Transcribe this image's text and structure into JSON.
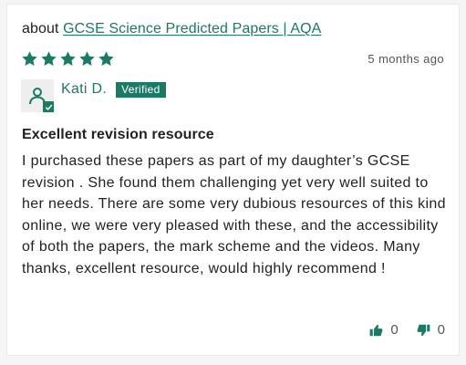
{
  "review": {
    "about_prefix": "about",
    "product_link": "GCSE Science Predicted Papers | AQA",
    "rating": 5,
    "rating_max": 5,
    "time_ago": "5 months ago",
    "reviewer_name": "Kati D.",
    "verified_label": "Verified",
    "title": "Excellent revision resource",
    "body": "I purchased these papers as part of my daughter’s GCSE revision . She found them challenging yet very well suited to her needs. There are some very dubious resources of this kind online, we were very pleased with these, and the accessibility of both the papers, the mark scheme and the videos. Many thanks, excellent resource, would highly recommend !",
    "upvotes": "0",
    "downvotes": "0"
  },
  "colors": {
    "accent": "#1b7a63",
    "text": "#222222",
    "muted": "#555555",
    "background": "#f5f5f5",
    "card": "#ffffff"
  },
  "icons": {
    "star": "star-icon",
    "user": "user-icon",
    "check": "check-icon",
    "thumbs_up": "thumbs-up-icon",
    "thumbs_down": "thumbs-down-icon"
  }
}
